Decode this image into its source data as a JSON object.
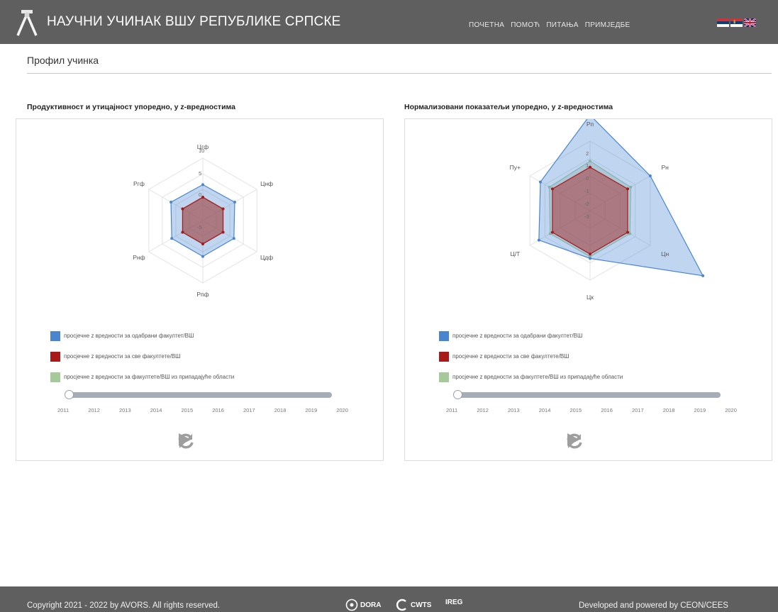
{
  "header": {
    "title": "НАУЧНИ УЧИНАК ВШУ РЕПУБЛИКЕ СРПСКЕ",
    "nav": [
      "ПОЧЕТНА",
      "ПОМОЋ",
      "ПИТАЊА",
      "ПРИМЈЕДБЕ"
    ],
    "flags": [
      "republic-srpska-flag-icon",
      "serbia-flag-icon",
      "uk-flag-icon"
    ]
  },
  "page": {
    "title": "Профил учинка"
  },
  "colors": {
    "selected": "#4a86d0",
    "all": "#a81919",
    "area": "#a6c99a",
    "header": "#5f5f5f"
  },
  "chart_data": [
    {
      "type": "radar",
      "title": "Продуктивност и утицајност упоредно, у z-вредностима",
      "axes": [
        "Цгф",
        "Цнф",
        "Цдф",
        "Рпф",
        "Рнф",
        "Ргф"
      ],
      "radial_ticks": [
        "10",
        "5",
        "0",
        "-5"
      ],
      "rlim": [
        -10,
        10
      ],
      "series": [
        {
          "name": "просјечне z вредности за одабрани факултет/ВШ",
          "color": "#4a86d0",
          "values": [
            1.5,
            1.8,
            1.5,
            1.5,
            1.5,
            1.8
          ]
        },
        {
          "name": "просјечне z вредности за све факултете/ВШ",
          "color": "#a81919",
          "values": [
            -2.5,
            -2.5,
            -2.5,
            -2.5,
            -2.5,
            -2.5
          ]
        },
        {
          "name": "просјечне z вредности за факултете/ВШ из припадајуће области",
          "color": "#a6c99a",
          "values": [
            -2.6,
            -2.6,
            -2.6,
            -2.6,
            -2.6,
            -2.6
          ]
        }
      ],
      "slider_years": [
        "2011",
        "2012",
        "2013",
        "2014",
        "2015",
        "2016",
        "2017",
        "2018",
        "2019",
        "2020"
      ],
      "selected_year": "2011"
    },
    {
      "type": "radar",
      "title": "Нормализовани показатељи упоредно, у z-вредностима",
      "axes": [
        "Рп",
        "Рн",
        "Цн",
        "Цк",
        "Ц/Т",
        "Пу+"
      ],
      "radial_ticks": [
        "2",
        "1",
        "0",
        "-1",
        "-2",
        "-3"
      ],
      "rlim": [
        -5,
        3
      ],
      "series": [
        {
          "name": "просјечне z вредности за одабрани факултет/ВШ",
          "color": "#4a86d0",
          "values": [
            6,
            3,
            10,
            0.5,
            1.8,
            1.6
          ]
        },
        {
          "name": "просјечне z вредности за све факултете/ВШ",
          "color": "#a81919",
          "values": [
            0,
            0,
            0,
            0,
            0,
            0
          ]
        },
        {
          "name": "просјечне z вредности за факултете/ВШ из припадајуће области",
          "color": "#a6c99a",
          "values": [
            0.7,
            0.4,
            0.3,
            0.3,
            0.3,
            0.4
          ]
        }
      ],
      "slider_years": [
        "2011",
        "2012",
        "2013",
        "2014",
        "2015",
        "2016",
        "2017",
        "2018",
        "2019",
        "2020"
      ],
      "selected_year": "2011"
    }
  ],
  "footer": {
    "copyright": "Copyright 2021 - 2022 by AVORS. All rights reserved.",
    "partners": [
      "DORA",
      "CWTS",
      "IREG"
    ],
    "powered": "Developed and powered by CEON/CEES"
  }
}
